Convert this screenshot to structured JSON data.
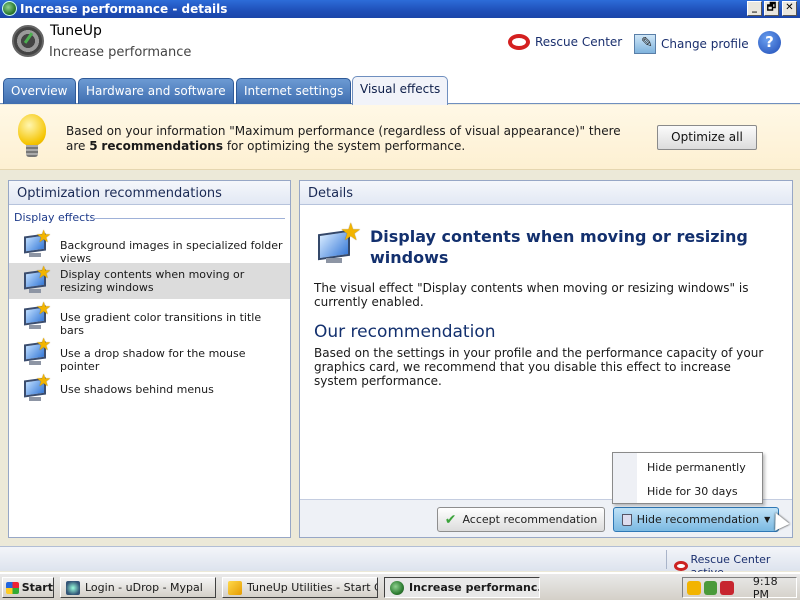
{
  "window": {
    "title": "Increase performance - details",
    "controls": {
      "minimize": "_",
      "restore": "🗗",
      "close": "✕"
    }
  },
  "header": {
    "brand": "TuneUp",
    "subtitle": "Increase performance",
    "rescue_center": "Rescue Center",
    "change_profile": "Change profile",
    "help": "?"
  },
  "tabs": [
    {
      "label": "Overview",
      "active": false
    },
    {
      "label": "Hardware and software",
      "active": false
    },
    {
      "label": "Internet settings",
      "active": false
    },
    {
      "label": "Visual effects",
      "active": true
    }
  ],
  "banner": {
    "text_before": "Based on your information \"Maximum performance (regardless of visual appearance)\" there are ",
    "count": "5",
    "text_bold": "recommendations",
    "text_after": " for optimizing the system performance.",
    "optimize_all": "Optimize all"
  },
  "left_panel": {
    "title": "Optimization recommendations",
    "section": "Display effects",
    "items": [
      {
        "label": "Background images in specialized folder views",
        "selected": false
      },
      {
        "label": "Display contents when moving or resizing windows",
        "selected": true
      },
      {
        "label": "Use gradient color transitions in title bars",
        "selected": false
      },
      {
        "label": "Use a drop shadow for the mouse pointer",
        "selected": false
      },
      {
        "label": "Use shadows behind menus",
        "selected": false
      }
    ]
  },
  "details": {
    "title": "Details",
    "effect_title": "Display contents when moving or resizing windows",
    "effect_text": "The visual effect \"Display contents when moving or resizing windows\" is currently enabled.",
    "recommendation_heading": "Our recommendation",
    "recommendation_text": "Based on the settings in your profile and the performance capacity of your graphics card, we recommend that you disable this effect to increase system performance.",
    "accept": "Accept recommendation",
    "hide": "Hide recommendation"
  },
  "dropdown": {
    "items": [
      "Hide permanently",
      "Hide for 30 days"
    ]
  },
  "statusbar": {
    "rescue_status": "Rescue Center active"
  },
  "taskbar": {
    "start": "Start",
    "tasks": [
      {
        "label": "Login - uDrop - Mypal",
        "active": false
      },
      {
        "label": "TuneUp Utilities - Start C...",
        "active": false
      },
      {
        "label": "Increase performanc...",
        "active": true
      }
    ],
    "clock": "9:18 PM"
  },
  "colors": {
    "titlebar": "#1f4fb8",
    "heading_blue": "#13306e",
    "banner_bg": "#fdf0d2",
    "accent_green": "#3ca33c"
  }
}
